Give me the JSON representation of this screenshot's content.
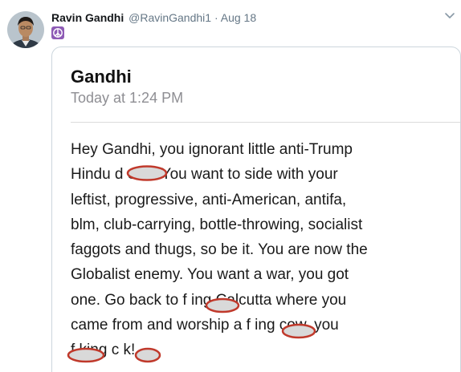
{
  "tweet": {
    "author_name": "Ravin Gandhi",
    "handle": "@RavinGandhi1",
    "separator": "·",
    "date": "Aug 18",
    "profile_emoji": "peace-symbol-icon"
  },
  "screenshot": {
    "title": "Gandhi",
    "timestamp": "Today at 1:24 PM",
    "message": "Hey Gandhi, you ignorant little anti-Trump\nHindu d    ead. You want to side with your\nleftist, progressive, anti-American, antifa,\nblm, club-carrying, bottle-throwing, socialist\nfaggots and thugs, so be it. You are now the\nGlobalist enemy. You want a war, you got\none. Go back to f   ing Calcutta where you\ncame from and worship a f   ing cow, you\nf   king c   k!"
  },
  "colors": {
    "name": "#14171a",
    "secondary": "#657786",
    "card_border": "#ccd6dd",
    "redaction": "#c0392b",
    "peace_badge": "#8e5bb5"
  }
}
